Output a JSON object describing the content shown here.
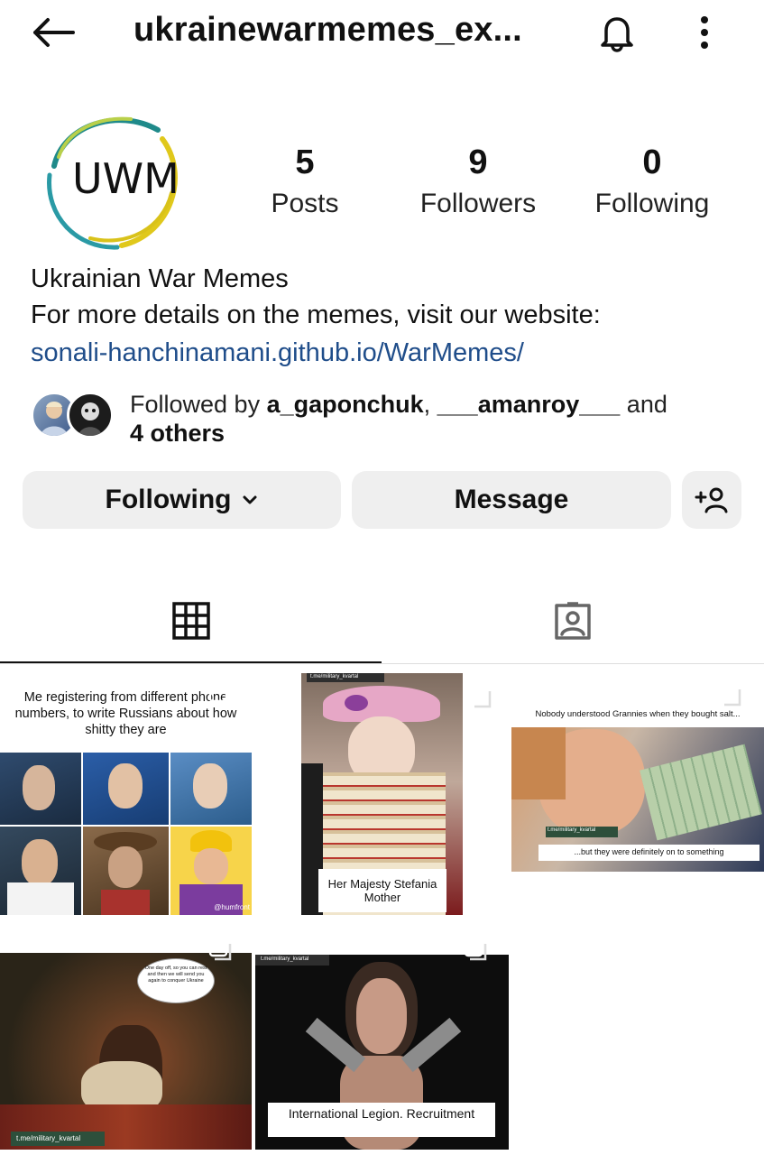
{
  "header": {
    "handle": "ukrainewarmemes_ex...",
    "icons": [
      "back-arrow-icon",
      "bell-icon",
      "more-vertical-icon"
    ]
  },
  "profile": {
    "avatar_text": "UWM",
    "stats": [
      {
        "num": "5",
        "label": "Posts"
      },
      {
        "num": "9",
        "label": "Followers"
      },
      {
        "num": "0",
        "label": "Following"
      }
    ],
    "name": "Ukrainian War Memes",
    "description": "For more details on the memes, visit our website:",
    "link": "sonali-hanchinamani.github.io/WarMemes/",
    "followed_by": {
      "prefix": "Followed by ",
      "user1": "a_gaponchuk",
      "sep": ", ",
      "user2": "___amanroy___",
      "and": " and",
      "others": "4 others"
    }
  },
  "actions": {
    "following": "Following",
    "message": "Message"
  },
  "tabs": [
    "grid-icon",
    "tagged-icon"
  ],
  "posts": [
    {
      "top_text": "Me registering from different phone numbers, to write Russians about how shitty they are",
      "credit": "@humfront"
    },
    {
      "source": "t.me/military_kvartal",
      "caption": "Her Majesty Stefania Mother"
    },
    {
      "top_text": "Nobody understood Grannies when they bought salt...",
      "source": "t.me/military_kvartal",
      "bottom_text": "...but they were definitely on to something"
    },
    {
      "bubble": "One day off, so you can rest and then we will send you again to conquer Ukraine",
      "source": "t.me/military_kvartal"
    },
    {
      "source": "t.me/military_kvartal",
      "caption": "International Legion. Recruitment"
    }
  ],
  "colors": {
    "link": "#1f4d8a",
    "button_bg": "#efefef",
    "text": "#111111"
  }
}
